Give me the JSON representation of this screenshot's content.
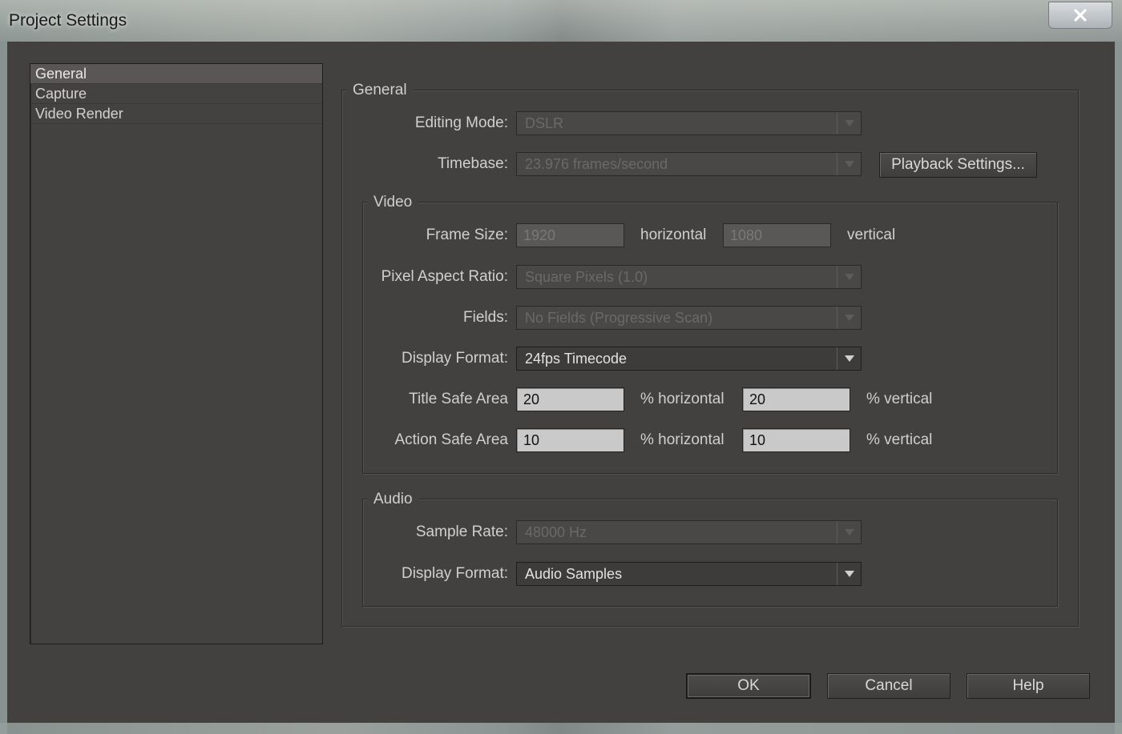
{
  "window": {
    "title": "Project Settings",
    "close_label": "✕"
  },
  "categories": [
    {
      "label": "General",
      "selected": true
    },
    {
      "label": "Capture",
      "selected": false
    },
    {
      "label": "Video Render",
      "selected": false
    }
  ],
  "general": {
    "group_title": "General",
    "editing_mode": {
      "label": "Editing Mode:",
      "value": "DSLR"
    },
    "timebase": {
      "label": "Timebase:",
      "value": "23.976 frames/second"
    },
    "playback_settings_label": "Playback Settings..."
  },
  "video": {
    "group_title": "Video",
    "frame_size": {
      "label": "Frame Size:",
      "width": "1920",
      "horizontal": "horizontal",
      "height": "1080",
      "vertical": "vertical"
    },
    "pixel_aspect_ratio": {
      "label": "Pixel Aspect Ratio:",
      "value": "Square Pixels (1.0)"
    },
    "fields": {
      "label": "Fields:",
      "value": "No Fields (Progressive Scan)"
    },
    "display_format": {
      "label": "Display Format:",
      "value": "24fps Timecode"
    },
    "title_safe": {
      "label": "Title Safe Area",
      "horizontal": "20",
      "h_unit": "% horizontal",
      "vertical": "20",
      "v_unit": "% vertical"
    },
    "action_safe": {
      "label": "Action Safe Area",
      "horizontal": "10",
      "h_unit": "% horizontal",
      "vertical": "10",
      "v_unit": "% vertical"
    }
  },
  "audio": {
    "group_title": "Audio",
    "sample_rate": {
      "label": "Sample Rate:",
      "value": "48000 Hz"
    },
    "display_format": {
      "label": "Display Format:",
      "value": "Audio Samples"
    }
  },
  "buttons": {
    "ok": "OK",
    "cancel": "Cancel",
    "help": "Help"
  }
}
